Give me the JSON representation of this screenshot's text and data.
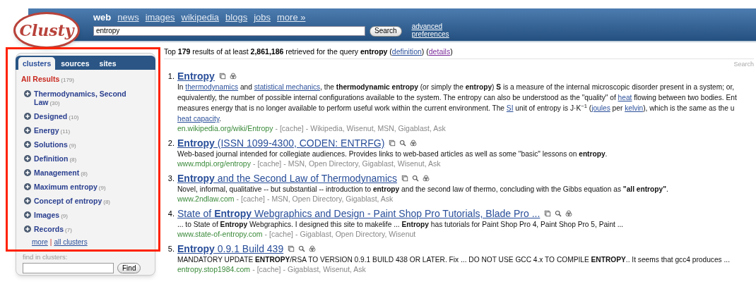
{
  "logo": {
    "text": "Clusty"
  },
  "nav": [
    {
      "label": "web",
      "selected": true
    },
    {
      "label": "news",
      "selected": false
    },
    {
      "label": "images",
      "selected": false
    },
    {
      "label": "wikipedia",
      "selected": false
    },
    {
      "label": "blogs",
      "selected": false
    },
    {
      "label": "jobs",
      "selected": false
    },
    {
      "label": "more »",
      "selected": false
    }
  ],
  "search": {
    "value": "entropy",
    "button": "Search",
    "advanced": "advanced",
    "preferences": "preferences"
  },
  "sidebar": {
    "tabs": [
      {
        "label": "clusters",
        "selected": true
      },
      {
        "label": "sources",
        "selected": false
      },
      {
        "label": "sites",
        "selected": false
      }
    ],
    "all_results": {
      "label": "All Results",
      "count": "(179)"
    },
    "clusters": [
      {
        "label": "Thermodynamics, Second Law",
        "count": "(30)"
      },
      {
        "label": "Designed",
        "count": "(10)"
      },
      {
        "label": "Energy",
        "count": "(11)"
      },
      {
        "label": "Solutions",
        "count": "(9)"
      },
      {
        "label": "Definition",
        "count": "(8)"
      },
      {
        "label": "Management",
        "count": "(8)"
      },
      {
        "label": "Maximum entropy",
        "count": "(9)"
      },
      {
        "label": "Concept of entropy",
        "count": "(8)"
      },
      {
        "label": "Images",
        "count": "(9)"
      },
      {
        "label": "Records",
        "count": "(7)"
      }
    ],
    "more": "more",
    "separator": "|",
    "all_clusters": "all clusters",
    "find_label": "find in clusters:",
    "find_button": "Find"
  },
  "summary": [
    {
      "kind": "text",
      "text": "Top **179** results of at least **2,861,186** retrieved for the query **entropy** ("
    },
    {
      "kind": "link",
      "text": "definition",
      "visited": false
    },
    {
      "kind": "text",
      "text": ") ("
    },
    {
      "kind": "link",
      "text": "details",
      "visited": true
    },
    {
      "kind": "text",
      "text": ")"
    }
  ],
  "search_corner": "Search",
  "results": [
    {
      "number": "1.",
      "title": "**Entropy**",
      "magnifier": false,
      "snippet": [
        [
          {
            "kind": "text",
            "text": "In "
          },
          {
            "kind": "link",
            "text": "thermodynamics"
          },
          {
            "kind": "text",
            "text": " and "
          },
          {
            "kind": "link",
            "text": "statistical mechanics"
          },
          {
            "kind": "text",
            "text": ", the **thermodynamic entropy** (or simply the **entropy**) **S** is a measure of the internal microscopic disorder present in a system; or,"
          }
        ],
        [
          {
            "kind": "text",
            "text": "equivalently, the number of possible internal configurations available to the system. The entropy can also be understood as the \"quality\" of "
          },
          {
            "kind": "link",
            "text": "heat"
          },
          {
            "kind": "text",
            "text": " flowing between two bodies. Ent"
          }
        ],
        [
          {
            "kind": "text",
            "text": "measures energy that is no longer available to perform useful work within the current environment. The "
          },
          {
            "kind": "link",
            "text": "SI"
          },
          {
            "kind": "text",
            "text": " unit of entropy is J·K$^{−1}$ ("
          },
          {
            "kind": "link",
            "text": "joules"
          },
          {
            "kind": "text",
            "text": " per "
          },
          {
            "kind": "link",
            "text": "kelvin"
          },
          {
            "kind": "text",
            "text": "), which is the same as the u"
          }
        ],
        [
          {
            "kind": "link",
            "text": "heat capacity"
          },
          {
            "kind": "text",
            "text": "."
          }
        ]
      ],
      "url": "en.wikipedia.org/wiki/Entropy",
      "dash": "-",
      "cache": "[cache]",
      "sources": "Wikipedia, Wisenut, MSN, Gigablast, Ask"
    },
    {
      "number": "2.",
      "title": "**Entropy** (ISSN 1099-4300, CODEN: ENTRFG)",
      "magnifier": true,
      "snippet": [
        [
          {
            "kind": "text",
            "text": "Web-based journal intended for collegiate audiences. Provides links to web-based articles as well as some \"basic\" lessons on **entropy**."
          }
        ]
      ],
      "url": "www.mdpi.org/entropy",
      "dash": "-",
      "cache": "[cache]",
      "sources": "MSN, Open Directory, Gigablast, Wisenut, Ask"
    },
    {
      "number": "3.",
      "title": "**Entropy** and the Second Law of Thermodynamics",
      "magnifier": true,
      "snippet": [
        [
          {
            "kind": "text",
            "text": "Novel, informal, qualitative -- but substantial -- introduction to **entropy** and the second law of thermo, concluding with the Gibbs equation as **\"all entropy\"**."
          }
        ]
      ],
      "url": "www.2ndlaw.com",
      "dash": "-",
      "cache": "[cache]",
      "sources": "MSN, Open Directory, Gigablast, Ask"
    },
    {
      "number": "4.",
      "title": "State of **Entropy** Webgraphics and Design - Paint Shop Pro Tutorials, Blade Pro ...",
      "magnifier": true,
      "snippet": [
        [
          {
            "kind": "text",
            "text": "... to State of **Entropy** Webgraphics. I designed this site to makelife ... **Entropy** has tutorials for Paint Shop Pro 4, Paint Shop Pro 5, Paint ..."
          }
        ]
      ],
      "url": "www.state-of-entropy.com",
      "dash": "-",
      "cache": "[cache]",
      "sources": "Gigablast, Open Directory, Wisenut"
    },
    {
      "number": "5.",
      "title": "**Entropy** 0.9.1 Build 439",
      "magnifier": true,
      "snippet": [
        [
          {
            "kind": "text",
            "text": "MANDATORY UPDATE **ENTROPY**/RSA TO VERSION 0.9.1 BUILD 438 OR LATER. Fix ... DO NOT USE GCC 4.x TO COMPILE **ENTROPY**.. It seems that gcc4 produces ..."
          }
        ]
      ],
      "url": "entropy.stop1984.com",
      "dash": "-",
      "cache": "[cache]",
      "sources": "Gigablast, Wisenut, Ask"
    }
  ]
}
